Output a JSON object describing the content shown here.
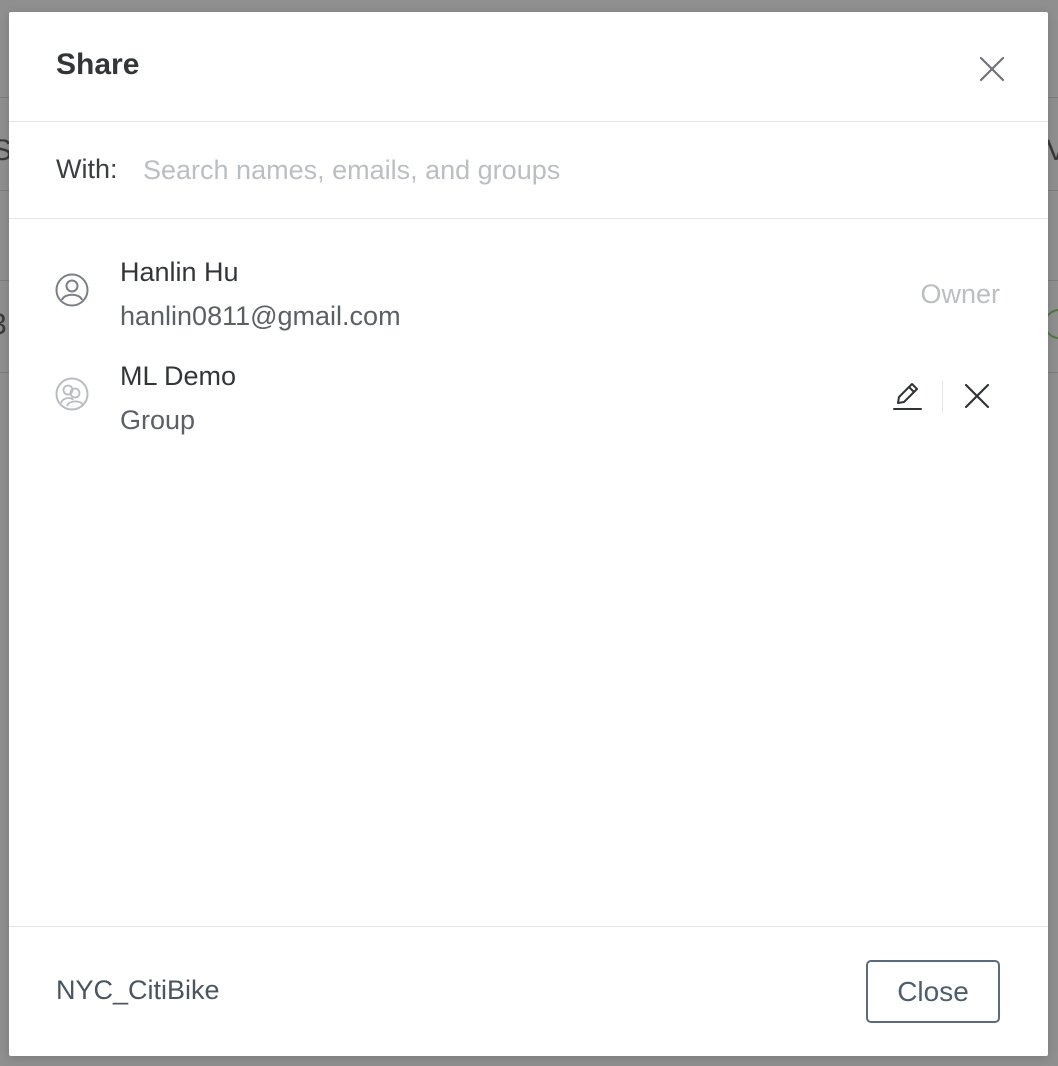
{
  "background": {
    "left_fragment_1": "S",
    "left_fragment_2": "3,",
    "right_fragment": "V"
  },
  "dialog": {
    "title": "Share",
    "with_label": "With:",
    "search_placeholder": "Search names, emails, and groups",
    "search_value": "",
    "members": [
      {
        "name": "Hanlin Hu",
        "detail": "hanlin0811@gmail.com",
        "role": "Owner",
        "icon": "user-circle-icon"
      },
      {
        "name": "ML Demo",
        "detail": "Group",
        "icon": "group-icon"
      }
    ],
    "footer_name": "NYC_CitiBike",
    "close_button_label": "Close"
  },
  "colors": {
    "overlay": "#8f8f8f",
    "title_text": "#333639",
    "muted_text": "#bbbec2",
    "button_border": "#5b6a7f"
  }
}
